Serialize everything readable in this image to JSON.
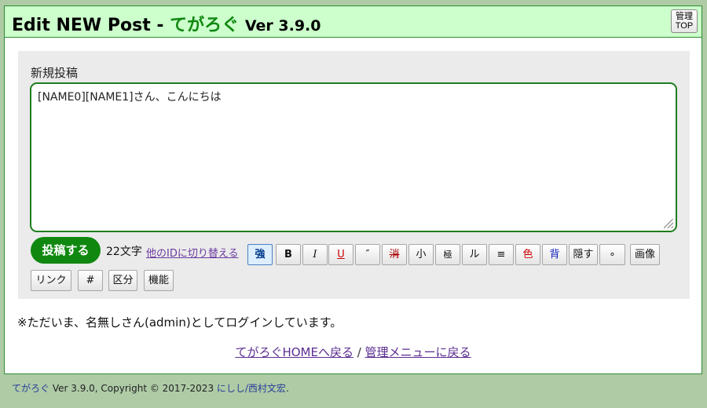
{
  "header": {
    "title_prefix": "Edit NEW Post - ",
    "app_name": "てがろぐ",
    "version": "Ver 3.9.0",
    "admin_top_line1": "管理",
    "admin_top_line2": "TOP"
  },
  "form": {
    "label": "新規投稿",
    "body_text": "[NAME0][NAME1]さん、こんにちは",
    "submit_label": "投稿する",
    "char_count": "22文字",
    "switch_id_link": "他のIDに切り替える"
  },
  "toolbar": {
    "strong": "強",
    "bold": "B",
    "italic": "I",
    "underline": "U",
    "quote": "″",
    "strike": "消",
    "small": "小",
    "tiny": "極",
    "ruby": "ル",
    "list": "≡",
    "color": "色",
    "background": "背",
    "hide": "隠す",
    "dot": "∘",
    "image": "画像",
    "link": "リンク",
    "hashtag": "#",
    "category": "区分",
    "features": "機能"
  },
  "notice": "※ただいま、名無しさん(admin)としてログインしています。",
  "links": {
    "home": "てがろぐHOMEへ戻る",
    "separator": " / ",
    "admin_menu": "管理メニューに戻る"
  },
  "footer": {
    "app_name": "てがろぐ",
    "text": " Ver 3.9.0, Copyright © 2017-2023 ",
    "author": "にしし/西村文宏",
    "end": "."
  },
  "colors": {
    "accent_green": "#108810",
    "header_bg": "#ccffcc",
    "outer_bg": "#aecba6"
  }
}
